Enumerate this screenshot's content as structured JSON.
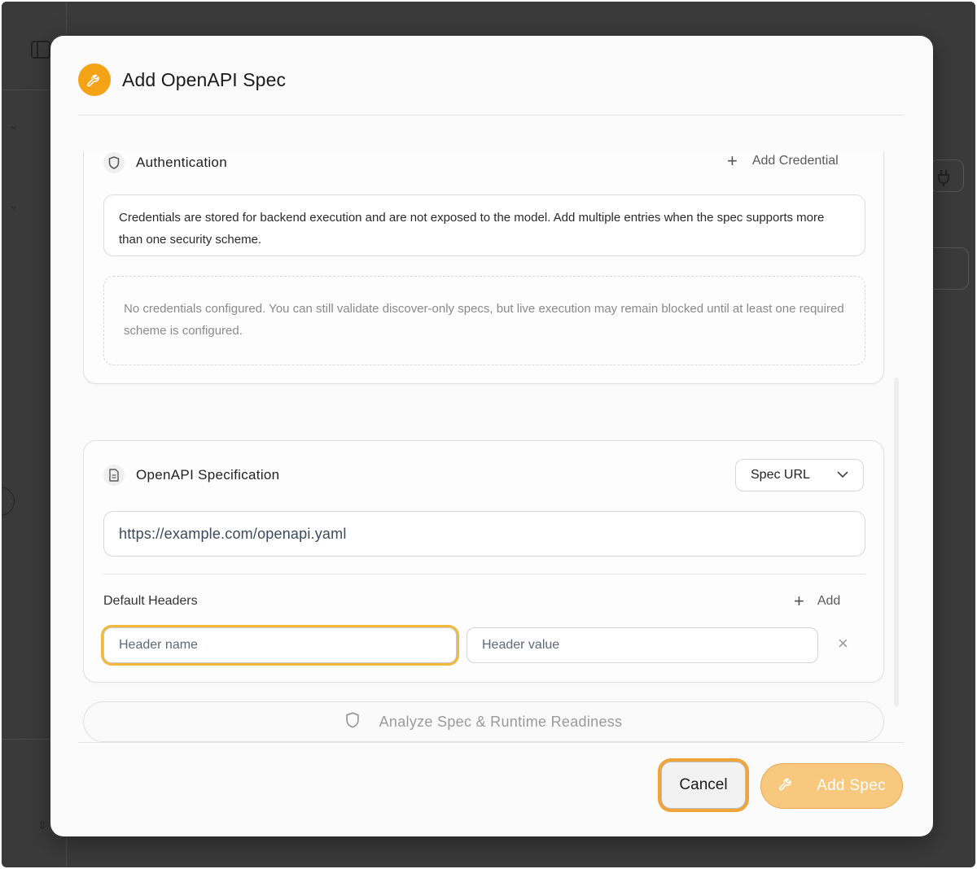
{
  "dialog": {
    "title": "Add OpenAPI Spec",
    "icon": "wrench-icon",
    "accent": "#f5a316"
  },
  "authentication": {
    "title": "Authentication",
    "icon": "shield-icon",
    "add_label": "Add Credential",
    "info": "Credentials are stored for backend execution and are not exposed to the model. Add multiple entries when the spec supports more than one security scheme.",
    "empty": "No credentials configured. You can still validate discover-only specs, but live execution may remain blocked until at least one required scheme is configured."
  },
  "spec": {
    "title": "OpenAPI Specification",
    "icon": "document-icon",
    "source_selected": "Spec URL",
    "url_value": "https://example.com/openapi.yaml",
    "headers_label": "Default Headers",
    "add_header_label": "Add",
    "header_name_placeholder": "Header name",
    "header_value_placeholder": "Header value"
  },
  "analyze_label": "Analyze Spec & Runtime Readiness",
  "footer": {
    "cancel_label": "Cancel",
    "add_label": "Add Spec"
  }
}
